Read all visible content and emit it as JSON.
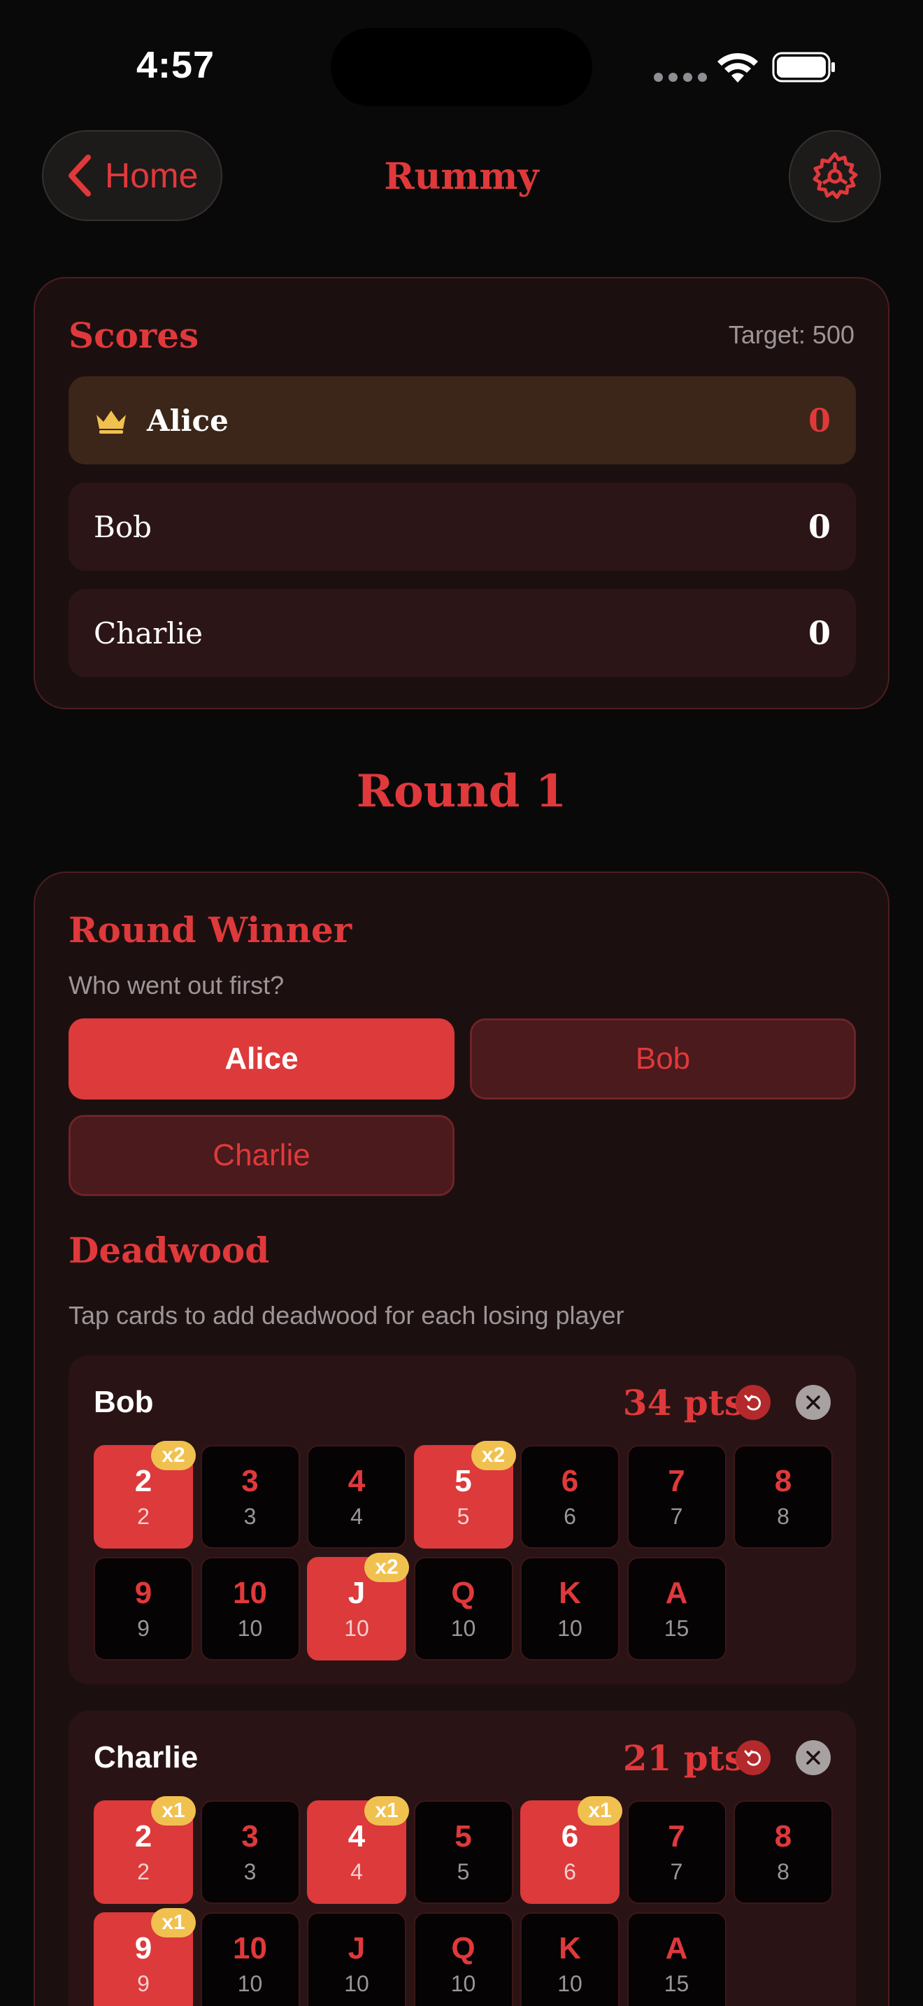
{
  "status": {
    "time": "4:57"
  },
  "header": {
    "back_label": "Home",
    "title": "Rummy",
    "back_icon": "chevron-left-icon",
    "settings_icon": "gear-icon"
  },
  "scores": {
    "title": "Scores",
    "target": "Target: 500",
    "players": [
      {
        "name": "Alice",
        "score": "0",
        "leader": true
      },
      {
        "name": "Bob",
        "score": "0",
        "leader": false
      },
      {
        "name": "Charlie",
        "score": "0",
        "leader": false
      }
    ]
  },
  "round": {
    "title": "Round 1",
    "winner_title": "Round Winner",
    "winner_prompt": "Who went out first?",
    "winner_options": [
      {
        "name": "Alice",
        "selected": true
      },
      {
        "name": "Bob",
        "selected": false
      },
      {
        "name": "Charlie",
        "selected": false
      }
    ],
    "deadwood_title": "Deadwood",
    "deadwood_hint": "Tap cards to add deadwood for each losing player",
    "losers": [
      {
        "name": "Bob",
        "points": "34 pts",
        "cards": [
          {
            "rank": "2",
            "value": "2",
            "mult": "x2"
          },
          {
            "rank": "3",
            "value": "3",
            "mult": ""
          },
          {
            "rank": "4",
            "value": "4",
            "mult": ""
          },
          {
            "rank": "5",
            "value": "5",
            "mult": "x2"
          },
          {
            "rank": "6",
            "value": "6",
            "mult": ""
          },
          {
            "rank": "7",
            "value": "7",
            "mult": ""
          },
          {
            "rank": "8",
            "value": "8",
            "mult": ""
          },
          {
            "rank": "9",
            "value": "9",
            "mult": ""
          },
          {
            "rank": "10",
            "value": "10",
            "mult": ""
          },
          {
            "rank": "J",
            "value": "10",
            "mult": "x2"
          },
          {
            "rank": "Q",
            "value": "10",
            "mult": ""
          },
          {
            "rank": "K",
            "value": "10",
            "mult": ""
          },
          {
            "rank": "A",
            "value": "15",
            "mult": ""
          }
        ]
      },
      {
        "name": "Charlie",
        "points": "21 pts",
        "cards": [
          {
            "rank": "2",
            "value": "2",
            "mult": "x1"
          },
          {
            "rank": "3",
            "value": "3",
            "mult": ""
          },
          {
            "rank": "4",
            "value": "4",
            "mult": "x1"
          },
          {
            "rank": "5",
            "value": "5",
            "mult": ""
          },
          {
            "rank": "6",
            "value": "6",
            "mult": "x1"
          },
          {
            "rank": "7",
            "value": "7",
            "mult": ""
          },
          {
            "rank": "8",
            "value": "8",
            "mult": ""
          },
          {
            "rank": "9",
            "value": "9",
            "mult": "x1"
          },
          {
            "rank": "10",
            "value": "10",
            "mult": ""
          },
          {
            "rank": "J",
            "value": "10",
            "mult": ""
          },
          {
            "rank": "Q",
            "value": "10",
            "mult": ""
          },
          {
            "rank": "K",
            "value": "10",
            "mult": ""
          },
          {
            "rank": "A",
            "value": "15",
            "mult": ""
          }
        ]
      }
    ]
  },
  "colors": {
    "accent": "#e0393b",
    "gold": "#f1c14f",
    "background": "#0a090a"
  }
}
